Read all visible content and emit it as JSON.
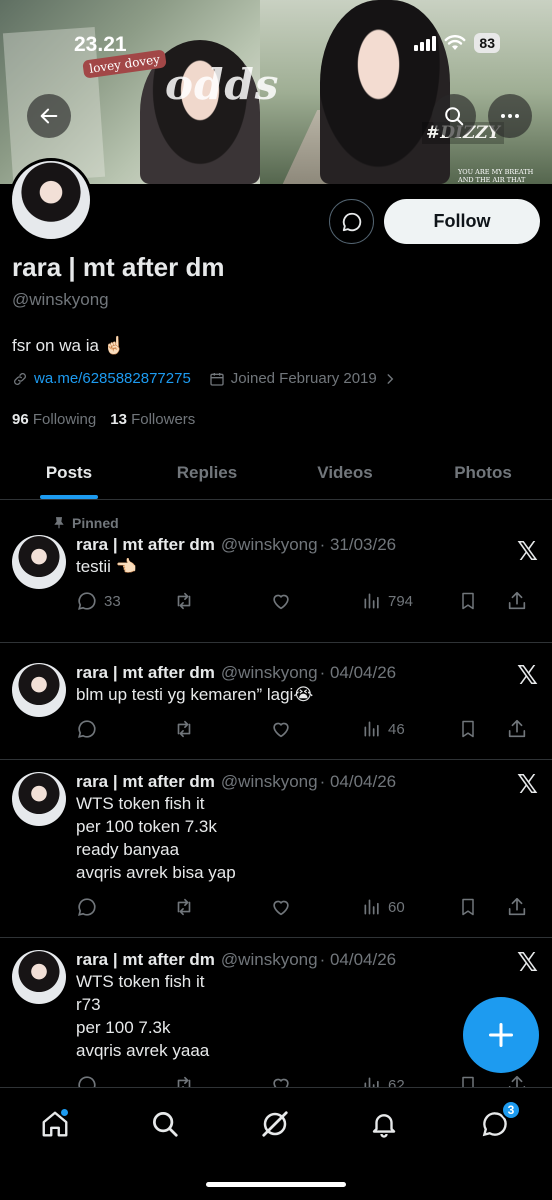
{
  "status_bar": {
    "time": "23.21",
    "battery": "83"
  },
  "banner": {
    "decor_text": [
      "lovey dovey",
      "odds",
      "#DIZZY",
      "YOU ARE MY BREATH AND THE AIR THAT KEEPS ME ALIVE"
    ]
  },
  "profile": {
    "display_name": "rara | mt after dm",
    "handle": "@winskyong",
    "bio": "fsr on wa ia",
    "bio_emoji": "☝🏻",
    "link": "wa.me/6285882877275",
    "joined": "Joined February 2019",
    "following_count": "96",
    "following_label": "Following",
    "followers_count": "13",
    "followers_label": "Followers"
  },
  "buttons": {
    "follow": "Follow"
  },
  "tabs": [
    {
      "label": "Posts",
      "active": true
    },
    {
      "label": "Replies",
      "active": false
    },
    {
      "label": "Videos",
      "active": false
    },
    {
      "label": "Photos",
      "active": false
    }
  ],
  "posts": [
    {
      "pinned_label": "Pinned",
      "name": "rara | mt after dm",
      "handle": "@winskyong",
      "date": "· 31/03/26",
      "text": "testii 👈🏻",
      "replies": "33",
      "reposts": "",
      "likes": "",
      "views": "794"
    },
    {
      "name": "rara | mt after dm",
      "handle": "@winskyong",
      "date": "· 04/04/26",
      "text": "blm up testi yg kemaren” lagi😭",
      "replies": "",
      "reposts": "",
      "likes": "",
      "views": "46"
    },
    {
      "name": "rara | mt after dm",
      "handle": "@winskyong",
      "date": "· 04/04/26",
      "text": "WTS token fish it\nper 100 token 7.3k\nready banyaa\navqris avrek bisa yap",
      "replies": "",
      "reposts": "",
      "likes": "",
      "views": "60"
    },
    {
      "name": "rara | mt after dm",
      "handle": "@winskyong",
      "date": "· 04/04/26",
      "text": "WTS token fish it\nr73\nper 100 7.3k\navqris avrek yaaa",
      "replies": "",
      "reposts": "",
      "likes": "",
      "views": "62"
    }
  ],
  "bottom_nav": {
    "messages_badge": "3"
  },
  "colors": {
    "accent": "#1d9bf0",
    "background": "#000000",
    "muted": "#71767b",
    "text": "#e7e9ea"
  },
  "icons": [
    "back-arrow-icon",
    "search-icon",
    "more-icon",
    "message-icon",
    "link-icon",
    "calendar-icon",
    "chevron-right-icon",
    "pin-icon",
    "x-logo-icon",
    "reply-icon",
    "repost-icon",
    "like-icon",
    "views-icon",
    "bookmark-icon",
    "share-icon",
    "compose-plus-icon",
    "home-icon",
    "grok-icon",
    "bell-icon",
    "chat-icon"
  ]
}
